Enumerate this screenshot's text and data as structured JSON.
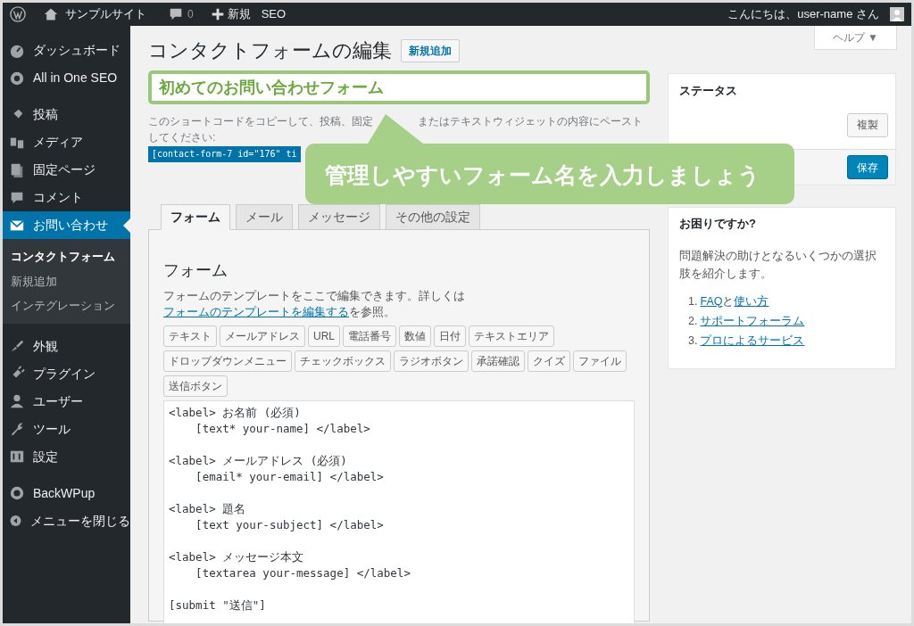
{
  "admin_bar": {
    "site_name": "サンプルサイト",
    "comments": "0",
    "new": "新規",
    "seo": "SEO",
    "greeting": "こんにちは、user-name さん"
  },
  "sidebar": {
    "groups": [
      [
        {
          "label": "ダッシュボード",
          "selected": false
        },
        {
          "label": "All in One SEO",
          "selected": false
        }
      ],
      [
        {
          "label": "投稿",
          "selected": false
        },
        {
          "label": "メディア",
          "selected": false
        },
        {
          "label": "固定ページ",
          "selected": false
        },
        {
          "label": "コメント",
          "selected": false
        },
        {
          "label": "お問い合わせ",
          "selected": true,
          "children": [
            {
              "label": "コンタクトフォーム",
              "selected": true
            },
            {
              "label": "新規追加",
              "selected": false
            },
            {
              "label": "インテグレーション",
              "selected": false
            }
          ]
        }
      ],
      [
        {
          "label": "外観",
          "selected": false
        },
        {
          "label": "プラグイン",
          "selected": false
        },
        {
          "label": "ユーザー",
          "selected": false
        },
        {
          "label": "ツール",
          "selected": false
        },
        {
          "label": "設定",
          "selected": false
        }
      ],
      [
        {
          "label": "BackWPup",
          "selected": false
        },
        {
          "label": "メニューを閉じる",
          "selected": false
        }
      ]
    ]
  },
  "help_button": "ヘルプ ▼",
  "page_title": "コンタクトフォームの編集",
  "add_new_button": "新規追加",
  "title_field": {
    "value": "初めてのお問い合わせフォーム",
    "highlighted": true
  },
  "shortcode_note": {
    "parts": [
      "このショートコードをコピーして、投稿、固定",
      "またはテキストウィジェットの内容にペースト"
    ],
    "line_2": "してください:"
  },
  "shortcode": "[contact-form-7 id=\"176\" ti",
  "callout": "管理しやすいフォーム名を入力しましょう",
  "tabs": [
    {
      "label": "フォーム",
      "selected": true
    },
    {
      "label": "メール",
      "selected": false
    },
    {
      "label": "メッセージ",
      "selected": false
    },
    {
      "label": "その他の設定",
      "selected": false
    }
  ],
  "form_panel": {
    "heading": "フォーム",
    "description_before": "フォームのテンプレートをここで編集できます。詳しくは",
    "description_link": "フォームのテンプレートを編集する",
    "description_after": "を参照。",
    "tag_buttons": [
      [
        "テキスト",
        "メールアドレス",
        "URL",
        "電話番号",
        "数値",
        "日付",
        "テキストエリア"
      ],
      [
        "ドロップダウンメニュー",
        "チェックボックス",
        "ラジオボタン",
        "承諾確認",
        "クイズ",
        "ファイル"
      ],
      [
        "送信ボタン"
      ]
    ],
    "code_blocks": [
      [
        "<label> お名前 (必須)",
        "    [text* your-name] </label>"
      ],
      [
        "<label> メールアドレス (必須)",
        "    [email* your-email] </label>"
      ],
      [
        "<label> 題名",
        "    [text your-subject] </label>"
      ],
      [
        "<label> メッセージ本文",
        "    [textarea your-message] </label>"
      ],
      [
        "[submit \"送信\"]"
      ]
    ]
  },
  "status_box": {
    "title": "ステータス",
    "duplicate_button": "複製",
    "save_button": "保存"
  },
  "help_box": {
    "title": "お困りですか?",
    "text": "問題解決の助けとなるいくつかの選択肢を紹介します。",
    "items": [
      {
        "number": "1.",
        "segments": [
          {
            "text": "FAQ",
            "link": true
          },
          {
            "text": "と",
            "link": false
          },
          {
            "text": "使い方",
            "link": true
          }
        ]
      },
      {
        "number": "2.",
        "segments": [
          {
            "text": "サポートフォーラム",
            "link": true
          }
        ]
      },
      {
        "number": "3.",
        "segments": [
          {
            "text": "プロによるサービス",
            "link": true
          }
        ]
      }
    ]
  }
}
